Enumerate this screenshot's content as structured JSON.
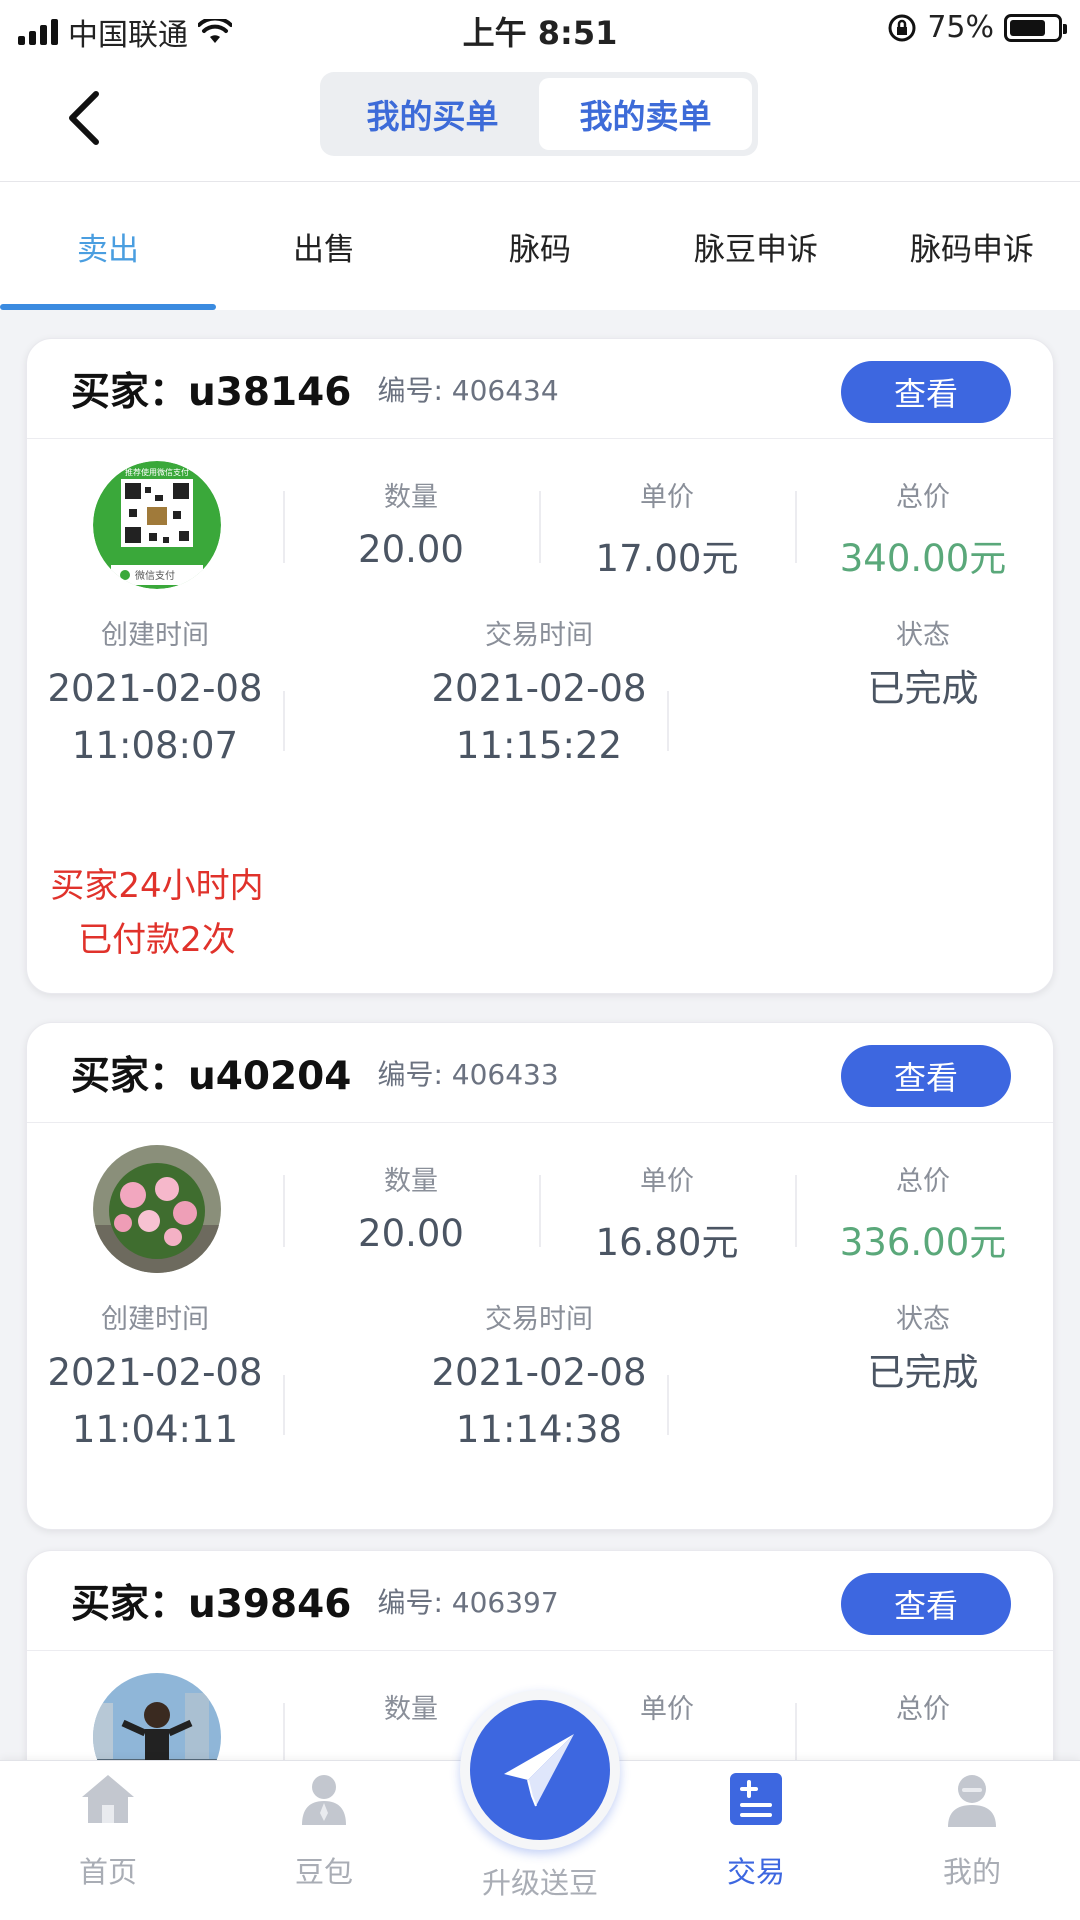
{
  "status_bar": {
    "carrier": "中国联通",
    "time": "上午 8:51",
    "battery": "75%",
    "battery_level": 0.75
  },
  "header": {
    "segments": [
      {
        "label": "我的买单",
        "active": false
      },
      {
        "label": "我的卖单",
        "active": true
      }
    ]
  },
  "tabs": [
    {
      "label": "卖出",
      "active": true
    },
    {
      "label": "出售"
    },
    {
      "label": "脉码"
    },
    {
      "label": "脉豆申诉"
    },
    {
      "label": "脉码申诉"
    }
  ],
  "labels": {
    "quantity": "数量",
    "unit_price": "单价",
    "total": "总价",
    "created": "创建时间",
    "traded": "交易时间",
    "status": "状态",
    "view": "查看"
  },
  "orders": [
    {
      "buyer": "买家：u38146",
      "number": "编号: 406434",
      "quantity": "20.00",
      "unit_price": "17.00元",
      "total": "340.00元",
      "created_date": "2021-02-08",
      "created_time": "11:08:07",
      "trade_date": "2021-02-08",
      "trade_time": "11:15:22",
      "status": "已完成",
      "warning_line1": "买家24小时内",
      "warning_line2": "已付款2次",
      "avatar": "wechat-pay-qr",
      "avatar_text": "推荐使用微信支付",
      "avatar_caption": "微信支付"
    },
    {
      "buyer": "买家：u40204",
      "number": "编号: 406433",
      "quantity": "20.00",
      "unit_price": "16.80元",
      "total": "336.00元",
      "created_date": "2021-02-08",
      "created_time": "11:04:11",
      "trade_date": "2021-02-08",
      "trade_time": "11:14:38",
      "status": "已完成",
      "avatar": "roses-photo"
    },
    {
      "buyer": "买家：u39846",
      "number": "编号: 406397",
      "avatar": "person-photo"
    }
  ],
  "bottom_nav": [
    {
      "label": "首页",
      "icon": "home-icon"
    },
    {
      "label": "豆包",
      "icon": "user-bag-icon"
    },
    {
      "label": "升级送豆",
      "icon": "paper-plane-icon"
    },
    {
      "label": "交易",
      "icon": "trade-icon",
      "active": true
    },
    {
      "label": "我的",
      "icon": "profile-icon"
    }
  ],
  "colors": {
    "accent": "#3d67e0",
    "tab_active": "#4a9ee0",
    "green": "#5aa87a",
    "warning": "#e0322b"
  }
}
